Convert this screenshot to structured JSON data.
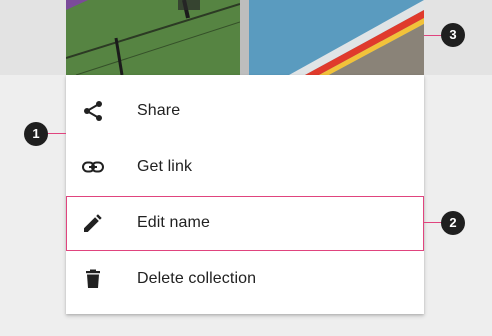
{
  "menu": {
    "items": [
      {
        "label": "Share",
        "icon": "share-icon"
      },
      {
        "label": "Get link",
        "icon": "link-icon"
      },
      {
        "label": "Edit name",
        "icon": "pencil-icon"
      },
      {
        "label": "Delete collection",
        "icon": "trash-icon"
      }
    ]
  },
  "callouts": [
    {
      "number": "1"
    },
    {
      "number": "2"
    },
    {
      "number": "3"
    }
  ],
  "colors": {
    "accent": "#e0447e",
    "badge": "#1f1f1f",
    "text": "#212121"
  }
}
